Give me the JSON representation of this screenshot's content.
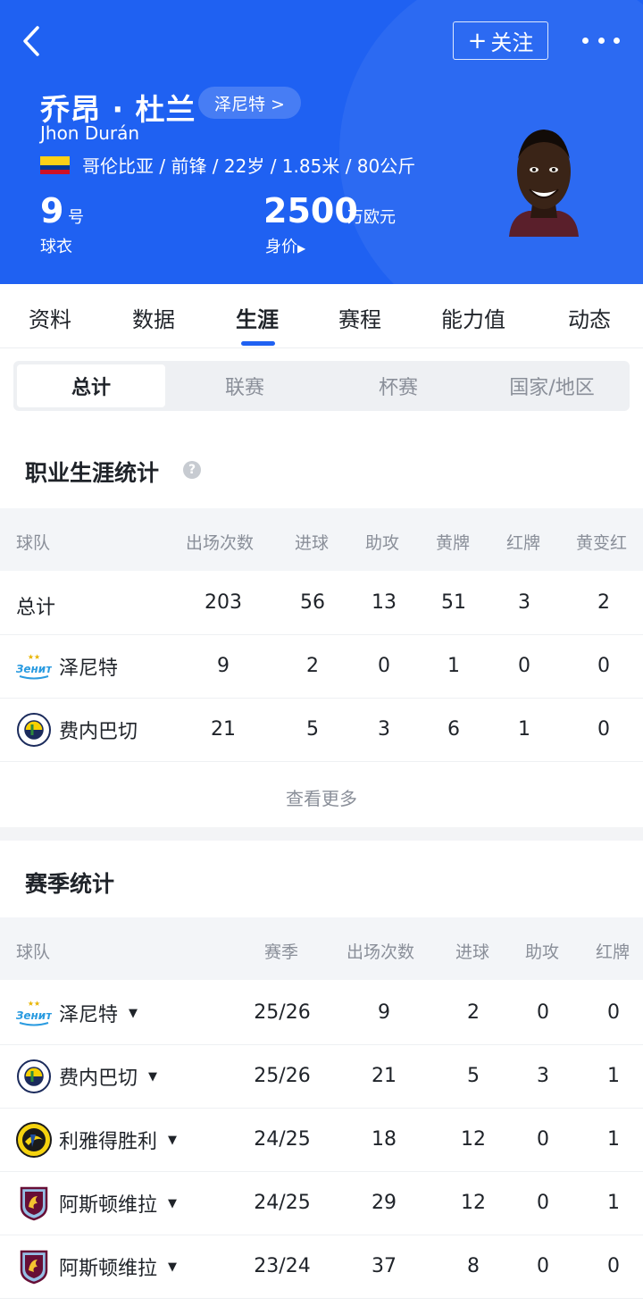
{
  "header": {
    "follow_label": "关注",
    "follow_plus": "+",
    "player_name_cn": "乔昂 · 杜兰",
    "team_chip": "泽尼特 >",
    "player_name_en": "Jhon Durán",
    "info_line": "哥伦比亚 / 前锋 / 22岁 / 1.85米 / 80公斤",
    "shirt_number": "9",
    "shirt_unit": "号",
    "shirt_label": "球衣",
    "market_value": "2500",
    "market_unit": "万欧元",
    "market_label": "身价",
    "market_arrow": "▶",
    "accent_color": "#1f61f2"
  },
  "tabs": [
    "资料",
    "数据",
    "生涯",
    "赛程",
    "能力值",
    "动态"
  ],
  "active_tab": "生涯",
  "segments": [
    "总计",
    "联赛",
    "杯赛",
    "国家/地区"
  ],
  "career": {
    "title": "职业生涯统计",
    "help": "?",
    "headers": [
      "球队",
      "出场次数",
      "进球",
      "助攻",
      "黄牌",
      "红牌",
      "黄变红"
    ],
    "rows": [
      {
        "team": "总计",
        "apps": "203",
        "goals": "56",
        "assists": "13",
        "yellow": "51",
        "red": "3",
        "second_yellow": "2"
      },
      {
        "team": "泽尼特",
        "logo": "zenit-logo",
        "apps": "9",
        "goals": "2",
        "assists": "0",
        "yellow": "1",
        "red": "0",
        "second_yellow": "0"
      },
      {
        "team": "费内巴切",
        "logo": "fenerbahce-logo",
        "apps": "21",
        "goals": "5",
        "assists": "3",
        "yellow": "6",
        "red": "1",
        "second_yellow": "0"
      }
    ],
    "more_label": "查看更多"
  },
  "season": {
    "title": "赛季统计",
    "headers": [
      "球队",
      "赛季",
      "出场次数",
      "进球",
      "助攻",
      "红牌"
    ],
    "rows": [
      {
        "team": "泽尼特",
        "logo": "zenit-logo",
        "season": "25/26",
        "apps": "9",
        "goals": "2",
        "assists": "0",
        "red": "0"
      },
      {
        "team": "费内巴切",
        "logo": "fenerbahce-logo",
        "season": "25/26",
        "apps": "21",
        "goals": "5",
        "assists": "3",
        "red": "1"
      },
      {
        "team": "利雅得胜利",
        "logo": "al-nassr-logo",
        "season": "24/25",
        "apps": "18",
        "goals": "12",
        "assists": "0",
        "red": "1"
      },
      {
        "team": "阿斯顿维拉",
        "logo": "aston-villa-logo",
        "season": "24/25",
        "apps": "29",
        "goals": "12",
        "assists": "0",
        "red": "1"
      },
      {
        "team": "阿斯顿维拉",
        "logo": "aston-villa-logo",
        "season": "23/24",
        "apps": "37",
        "goals": "8",
        "assists": "0",
        "red": "0"
      }
    ]
  }
}
